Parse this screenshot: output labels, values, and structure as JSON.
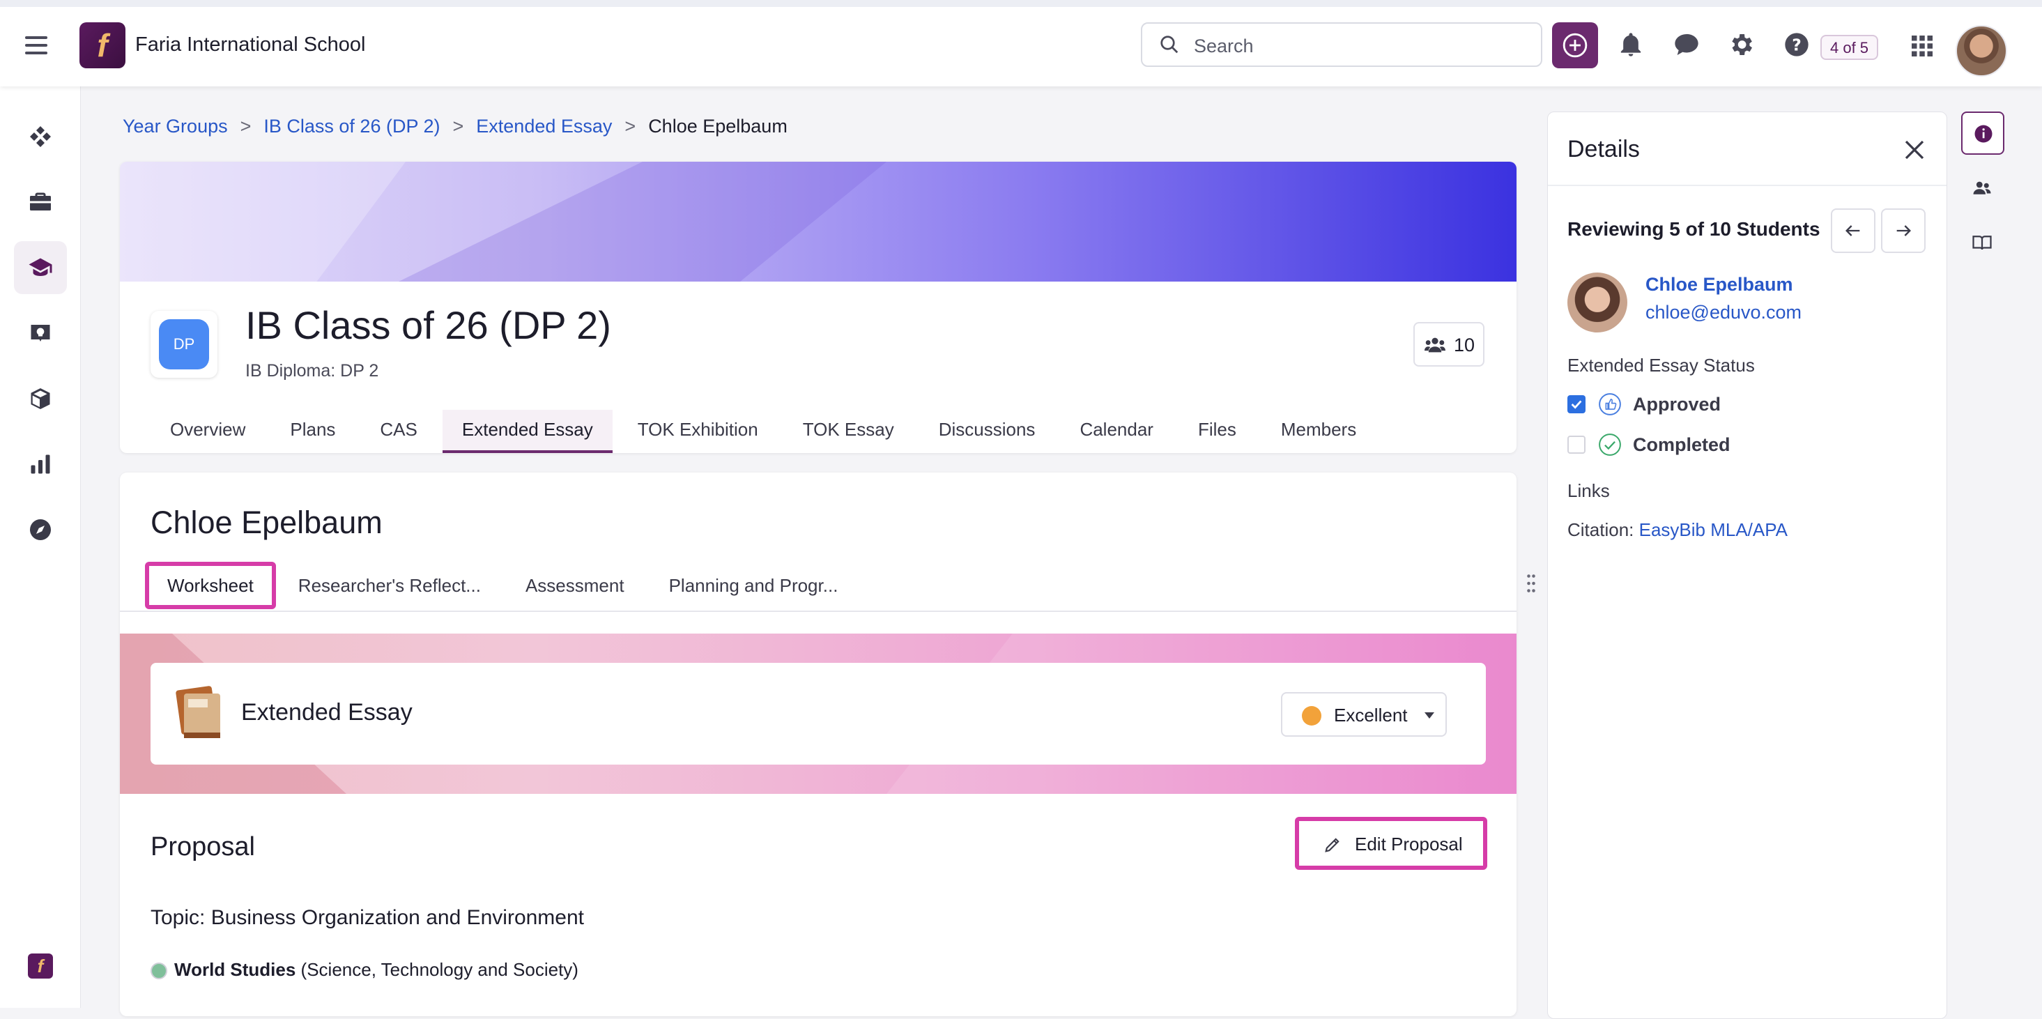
{
  "topbar": {
    "school_name": "Faria International School",
    "logo_letter": "f",
    "search_placeholder": "Search",
    "counter": "4 of 5",
    "icons": [
      "menu-icon",
      "plus-circle-icon",
      "bell-icon",
      "chat-icon",
      "gear-icon",
      "help-icon",
      "apps-grid-icon"
    ]
  },
  "sidebar": {
    "items": [
      "dashboard-icon",
      "briefcase-icon",
      "graduation-cap-icon",
      "lightbulb-icon",
      "cube-icon",
      "bar-chart-icon",
      "compass-icon"
    ],
    "active": "graduation-cap-icon"
  },
  "breadcrumb": {
    "items": [
      "Year Groups",
      "IB Class of 26 (DP 2)",
      "Extended Essay"
    ],
    "current": "Chloe Epelbaum"
  },
  "class": {
    "icon_text": "DP",
    "title": "IB Class of 26 (DP 2)",
    "subtitle": "IB Diploma: DP 2",
    "member_count": "10",
    "tabs": [
      "Overview",
      "Plans",
      "CAS",
      "Extended Essay",
      "TOK Exhibition",
      "TOK Essay",
      "Discussions",
      "Calendar",
      "Files",
      "Members"
    ],
    "active_tab": "Extended Essay"
  },
  "student": {
    "name": "Chloe Epelbaum",
    "tabs": [
      "Worksheet",
      "Researcher's Reflect...",
      "Assessment",
      "Planning and Progr..."
    ],
    "active_tab": "Worksheet",
    "essay_card_title": "Extended Essay",
    "grade_value": "Excellent",
    "proposal_heading": "Proposal",
    "edit_proposal_label": "Edit Proposal",
    "topic": "Topic: Business Organization and Environment",
    "world_studies_bold": "World Studies",
    "world_studies_rest": " (Science, Technology and Society)"
  },
  "details": {
    "title": "Details",
    "reviewing": "Reviewing 5 of 10 Students",
    "student_name": "Chloe Epelbaum",
    "student_email": "chloe@eduvo.com",
    "status_heading": "Extended Essay Status",
    "approved_label": "Approved",
    "approved_checked": true,
    "completed_label": "Completed",
    "completed_checked": false,
    "links_heading": "Links",
    "citation_prefix": "Citation: ",
    "citation_link": "EasyBib MLA/APA"
  },
  "right_rail": {
    "items": [
      "info-icon",
      "people-icon",
      "book-open-icon"
    ],
    "active": "info-icon"
  },
  "colors": {
    "brand_purple": "#6b2a6e",
    "link_blue": "#2857c7",
    "highlight_pink": "#d63ca8",
    "checkbox_blue": "#2c6fe0"
  }
}
